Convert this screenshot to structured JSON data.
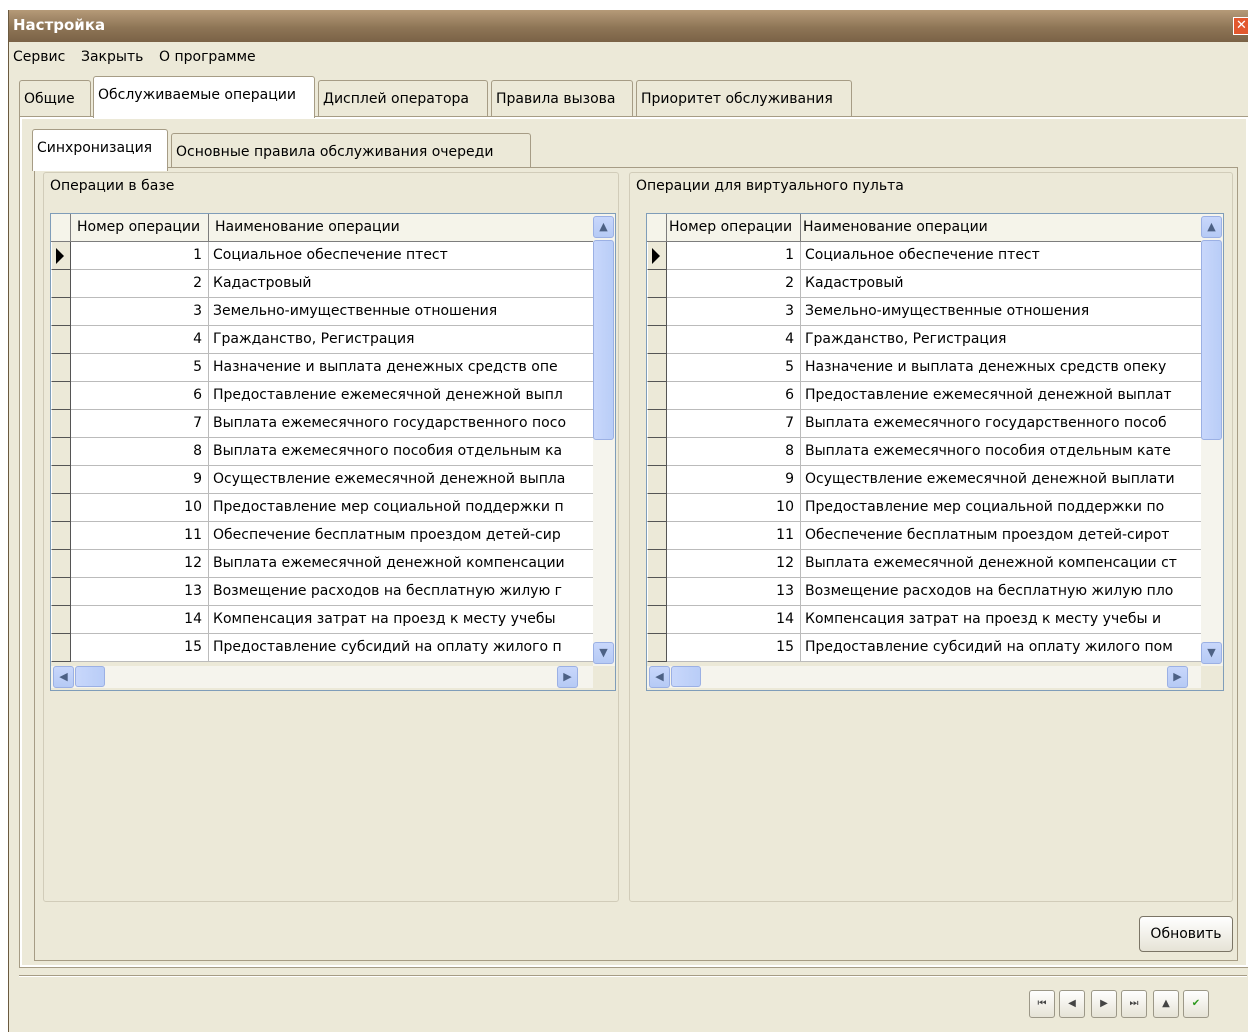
{
  "window": {
    "title": "Настройка",
    "close_glyph": "✕"
  },
  "menu": {
    "service": "Сервис",
    "close": "Закрыть",
    "about": "О программе"
  },
  "tabs": [
    "Общие",
    "Обслуживаемые операции",
    "Дисплей оператора",
    "Правила вызова",
    "Приоритет обслуживания"
  ],
  "active_tab": "Обслуживаемые операции",
  "subtabs": [
    "Синхронизация",
    "Основные правила обслуживания  очереди"
  ],
  "active_subtab": "Синхронизация",
  "left_panel": {
    "title": "Операции в базе",
    "headers": {
      "num": "Номер операции",
      "name": "Наименование операции"
    },
    "rows": [
      {
        "num": "1",
        "name": "Социальное обеспечение птест"
      },
      {
        "num": "2",
        "name": "Кадастровый"
      },
      {
        "num": "3",
        "name": "Земельно-имущественные отношения"
      },
      {
        "num": "4",
        "name": "Гражданство, Регистрация"
      },
      {
        "num": "5",
        "name": "Назначение и выплата денежных средств опе"
      },
      {
        "num": "6",
        "name": "Предоставление ежемесячной денежной выпл"
      },
      {
        "num": "7",
        "name": "Выплата ежемесячного государственного посо"
      },
      {
        "num": "8",
        "name": "Выплата ежемесячного пособия отдельным ка"
      },
      {
        "num": "9",
        "name": "Осуществление ежемесячной денежной выпла"
      },
      {
        "num": "10",
        "name": "Предоставление мер социальной поддержки п"
      },
      {
        "num": "11",
        "name": "Обеспечение бесплатным проездом детей-сир"
      },
      {
        "num": "12",
        "name": "Выплата ежемесячной денежной компенсации"
      },
      {
        "num": "13",
        "name": "Возмещение расходов на бесплатную жилую г"
      },
      {
        "num": "14",
        "name": "Компенсация затрат на проезд к месту учебы"
      },
      {
        "num": "15",
        "name": "Предоставление субсидий на оплату жилого п"
      }
    ]
  },
  "right_panel": {
    "title": "Операции для виртуального пульта",
    "headers": {
      "num": "Номер операции",
      "name": "Наименование операции"
    },
    "rows": [
      {
        "num": "1",
        "name": "Социальное обеспечение птест"
      },
      {
        "num": "2",
        "name": "Кадастровый"
      },
      {
        "num": "3",
        "name": "Земельно-имущественные отношения"
      },
      {
        "num": "4",
        "name": "Гражданство, Регистрация"
      },
      {
        "num": "5",
        "name": "Назначение и выплата денежных средств опеку"
      },
      {
        "num": "6",
        "name": "Предоставление ежемесячной денежной выплат"
      },
      {
        "num": "7",
        "name": "Выплата ежемесячного государственного пособ"
      },
      {
        "num": "8",
        "name": "Выплата ежемесячного пособия отдельным кате"
      },
      {
        "num": "9",
        "name": "Осуществление ежемесячной денежной выплати"
      },
      {
        "num": "10",
        "name": "Предоставление мер социальной поддержки по"
      },
      {
        "num": "11",
        "name": "Обеспечение бесплатным проездом детей-сирот"
      },
      {
        "num": "12",
        "name": "Выплата ежемесячной денежной компенсации ст"
      },
      {
        "num": "13",
        "name": "Возмещение расходов на бесплатную жилую пло"
      },
      {
        "num": "14",
        "name": "Компенсация затрат на проезд к месту учебы и"
      },
      {
        "num": "15",
        "name": "Предоставление субсидий на оплату жилого пом"
      }
    ]
  },
  "refresh_button": "Обновить",
  "navigator": {
    "first": "⏮",
    "prior": "◀",
    "next": "▶",
    "last": "⏭",
    "up": "▲",
    "post": "✔"
  },
  "icons": {
    "up": "▲",
    "down": "▼",
    "left": "◀",
    "right": "▶"
  }
}
